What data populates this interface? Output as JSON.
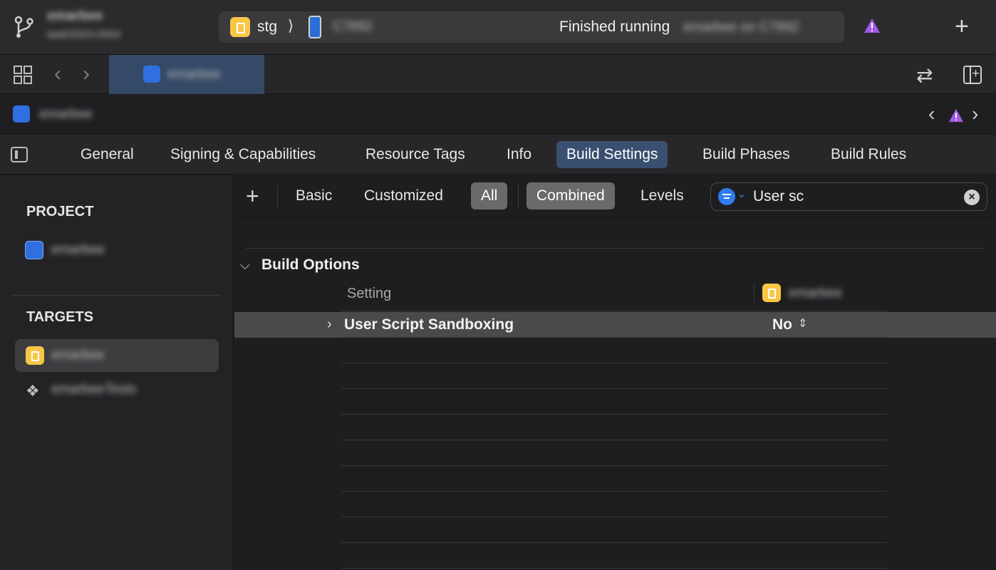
{
  "titlebar": {
    "project_name": "emarbee",
    "branch": "task/2023-0004",
    "scheme": "stg",
    "scheme_chevron": "⟩",
    "device": "C7892",
    "status": "Finished running",
    "status_target": "emarbee on C7892",
    "warning_icon": "warning-triangle-icon",
    "add_icon": "plus-icon"
  },
  "tabbar": {
    "active_tab": "emarbee"
  },
  "jumpbar": {
    "label": "emarbee"
  },
  "editor_tabs": {
    "general": "General",
    "signing": "Signing & Capabilities",
    "resource_tags": "Resource Tags",
    "info": "Info",
    "build_settings": "Build Settings",
    "build_phases": "Build Phases",
    "build_rules": "Build Rules"
  },
  "sidebar": {
    "project_header": "PROJECT",
    "project_item": "emarbee",
    "targets_header": "TARGETS",
    "targets": [
      "emarbee",
      "emarbeeTests"
    ]
  },
  "filterbar": {
    "basic": "Basic",
    "customized": "Customized",
    "all": "All",
    "combined": "Combined",
    "levels": "Levels",
    "search_value": "User sc"
  },
  "settings": {
    "group_title": "Build Options",
    "col_setting": "Setting",
    "col_target": "emarbee",
    "row_name": "User Script Sandboxing",
    "row_value": "No"
  },
  "colors": {
    "accent": "#3a5070",
    "warning": "#a259e6",
    "app_icon": "#f7c744",
    "project_icon": "#2f6fe0"
  }
}
